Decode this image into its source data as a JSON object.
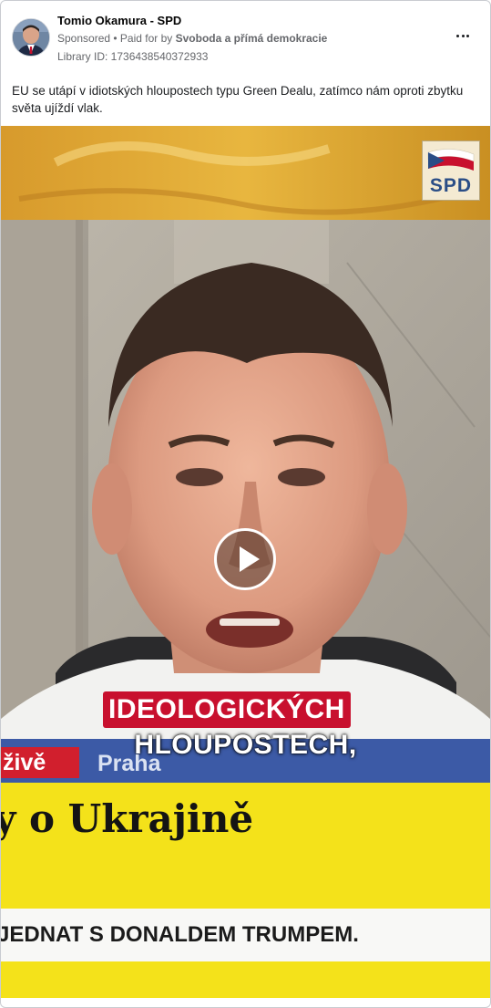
{
  "post": {
    "page_name": "Tomio Okamura - SPD",
    "sponsored_label": "Sponsored",
    "separator": " • ",
    "paid_for_prefix": "Paid for by ",
    "payer": "Svoboda a přímá demokracie",
    "library_id": "Library ID: 1736438540372933",
    "text": "EU se utápí v idiotských hloupostech typu Green Dealu, zatímco nám oproti zbytku světa ujíždí vlak.",
    "more_icon": "more-horizontal-icon"
  },
  "video": {
    "logo_text": "SPD",
    "caption_line1": "IDEOLOGICKÝCH",
    "caption_line2": "HLOUPOSTECH,",
    "live_label": "živě",
    "city_label": "Praha",
    "headline": "y o Ukrajině",
    "ticker": "JEDNAT S DONALDEM TRUMPEM.",
    "play_icon": "play-icon"
  },
  "colors": {
    "caption_red": "#c8102e",
    "news_yellow": "#f4e21a",
    "news_blue": "#3c5aa6",
    "live_red": "#d11f2d"
  }
}
